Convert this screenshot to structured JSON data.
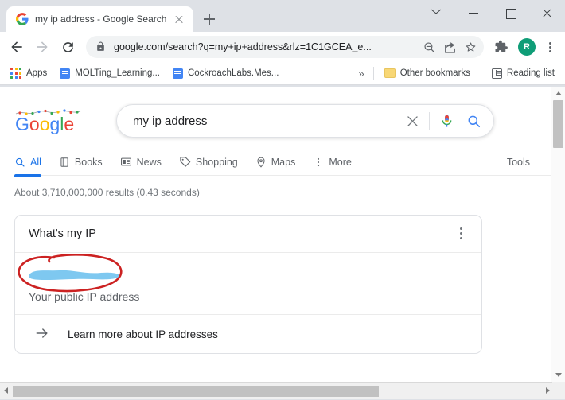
{
  "window": {
    "controls": {
      "tab_search": "tab-search-chevron",
      "minimize": "minimize",
      "maximize": "maximize",
      "close": "close"
    }
  },
  "tab": {
    "title": "my ip address - Google Search",
    "favicon": "google-g-icon",
    "close_label": "",
    "new_tab_label": ""
  },
  "toolbar": {
    "back": "back-arrow",
    "forward": "forward-arrow",
    "reload": "reload",
    "url_secure": "google.com/search?q=my+ip+address",
    "url_rest": "&rlz=1C1GCEA_e...",
    "url_full": "google.com/search?q=my+ip+address&rlz=1C1GCEA_e...",
    "zoom_icon": "zoom-out-icon",
    "share_icon": "share-icon",
    "bookmark_icon": "star-icon",
    "extensions_icon": "puzzle-icon",
    "avatar_letter": "R",
    "avatar_color": "#0f9d77",
    "menu_icon": "three-dot-menu-icon"
  },
  "bookmarks": {
    "apps_label": "Apps",
    "items": [
      {
        "label": "MOLTing_Learning...",
        "icon": "google-docs-icon"
      },
      {
        "label": "CockroachLabs.Mes...",
        "icon": "google-docs-icon"
      }
    ],
    "overflow": "»",
    "other_bookmarks": "Other bookmarks",
    "reading_list": "Reading list"
  },
  "search": {
    "logo": "google-logo-holiday-lights",
    "query": "my ip address",
    "clear_icon": "clear-x-icon",
    "mic_icon": "microphone-icon",
    "search_icon": "search-icon"
  },
  "nav": {
    "tabs": [
      {
        "label": "All",
        "icon": "search-icon",
        "active": true
      },
      {
        "label": "Books",
        "icon": "book-icon",
        "active": false
      },
      {
        "label": "News",
        "icon": "news-icon",
        "active": false
      },
      {
        "label": "Shopping",
        "icon": "tag-icon",
        "active": false
      },
      {
        "label": "Maps",
        "icon": "pin-icon",
        "active": false
      },
      {
        "label": "More",
        "icon": "more-vertical-icon",
        "active": false
      }
    ],
    "tools_label": "Tools"
  },
  "results": {
    "stats": "About 3,710,000,000 results (0.43 seconds)",
    "card": {
      "title": "What's my IP",
      "menu_icon": "three-dot-menu-icon",
      "ip_value_redacted": "",
      "ip_caption": "Your public IP address",
      "footer_label": "Learn more about IP addresses",
      "footer_icon": "arrow-right-icon",
      "redaction_color": "#7ec8f0",
      "annotation_color": "#cc2222"
    }
  },
  "scrollbars": {
    "vertical": "vertical-scrollbar",
    "horizontal": "horizontal-scrollbar"
  }
}
